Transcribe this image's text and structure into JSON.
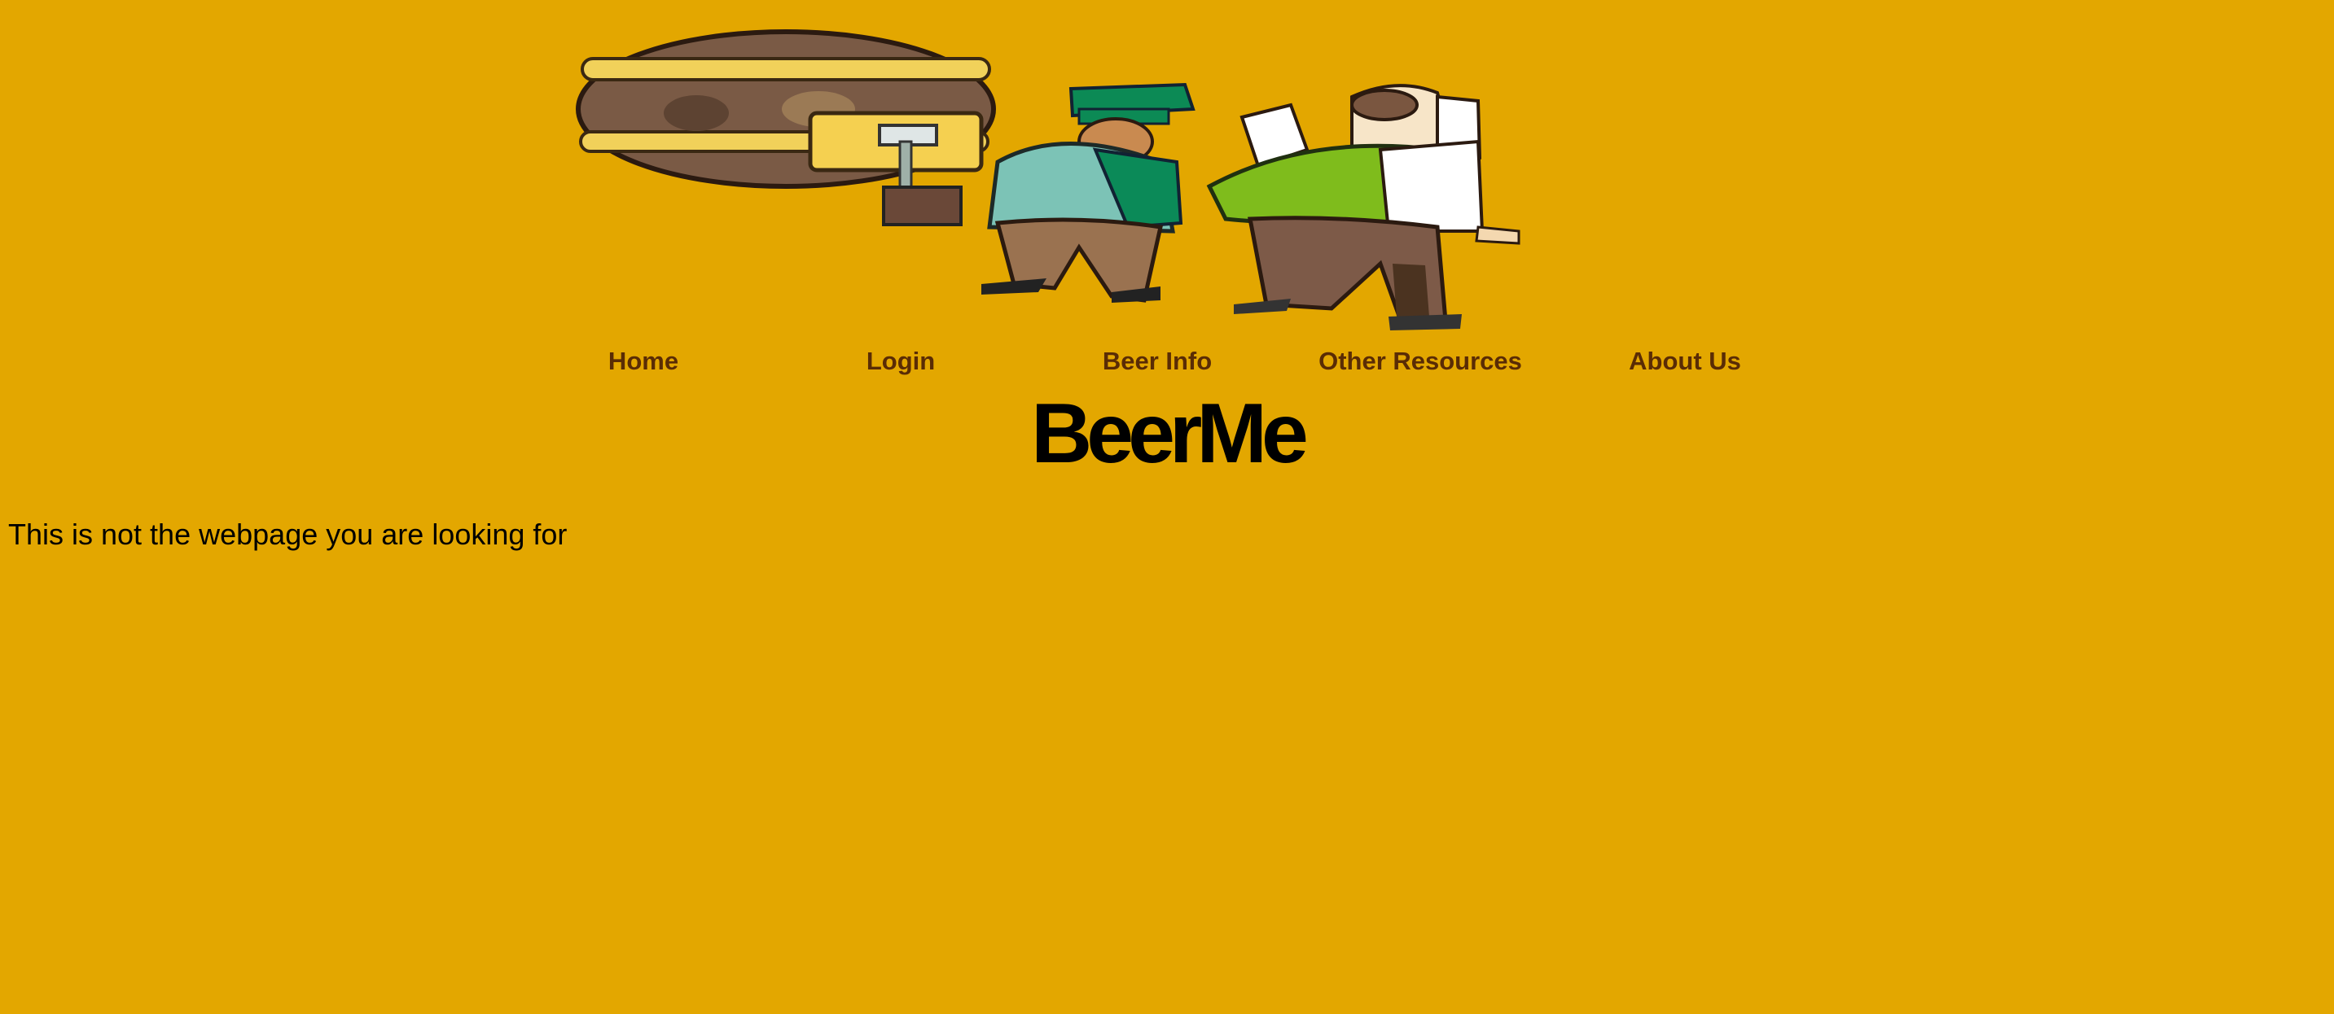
{
  "banner": {
    "image_description": "cartoon-beer-keg-carriers"
  },
  "nav": {
    "items": [
      {
        "label": "Home"
      },
      {
        "label": "Login"
      },
      {
        "label": "Beer Info"
      },
      {
        "label": "Other Resources"
      },
      {
        "label": "About Us"
      }
    ]
  },
  "header": {
    "title": "BeerMe"
  },
  "main": {
    "message": "This is not the webpage you are looking for"
  },
  "colors": {
    "background": "#e3a700",
    "nav_link": "#5a2c05",
    "text": "#000000"
  }
}
